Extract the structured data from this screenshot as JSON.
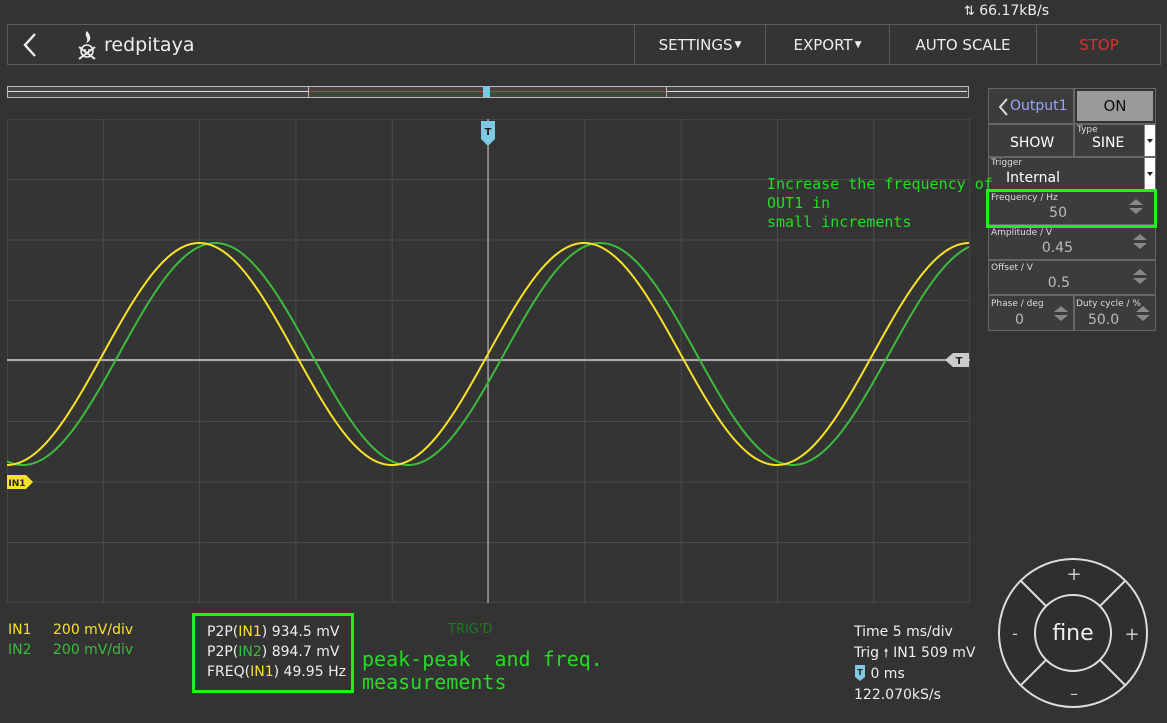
{
  "status": {
    "net_speed": "66.17kB/s"
  },
  "navbar": {
    "brand": "redpitaya",
    "settings_label": "SETTINGS",
    "export_label": "EXPORT",
    "autoscale_label": "AUTO SCALE",
    "stop_label": "STOP"
  },
  "colors": {
    "in1": "#f7e227",
    "in2": "#3dbb3d",
    "stop": "#e03030",
    "trigger_marker": "#7ec8e3",
    "highlight": "#22ee22"
  },
  "graph": {
    "trigger_marker_label": "T",
    "trigger_level_label": "T",
    "in1_marker_label": "IN1",
    "trig_state": "TRIG'D"
  },
  "output_panel": {
    "output_label": "Output1",
    "on_label": "ON",
    "show_label": "SHOW",
    "type_label": "Type",
    "type_value": "SINE",
    "trigger_label": "Trigger",
    "trigger_value": "Internal",
    "frequency_label": "Frequency / Hz",
    "frequency_value": "50",
    "amplitude_label": "Amplitude / V",
    "amplitude_value": "0.45",
    "offset_label": "Offset / V",
    "offset_value": "0.5",
    "phase_label": "Phase / deg",
    "phase_value": "0",
    "duty_label": "Duty cycle / %",
    "duty_value": "50.0"
  },
  "annotations": {
    "frequency_hint_line1": "Increase the frequency of",
    "frequency_hint_line2": "OUT1 in",
    "frequency_hint_line3": "small increments",
    "measure_hint_line1": "peak-peak  and freq.",
    "measure_hint_line2": "measurements"
  },
  "channels": [
    {
      "name": "IN1",
      "scale": "200 mV/div"
    },
    {
      "name": "IN2",
      "scale": "200 mV/div"
    }
  ],
  "measurements": {
    "p2p_in1_prefix": "P2P(",
    "p2p_in1_ch": "IN1",
    "p2p_in1_suffix": ") 934.5 mV",
    "p2p_in2_prefix": "P2P(",
    "p2p_in2_ch": "IN2",
    "p2p_in2_suffix": ") 894.7 mV",
    "freq_in1_prefix": "FREQ(",
    "freq_in1_ch": "IN1",
    "freq_in1_suffix": ") 49.95 Hz"
  },
  "timebase": {
    "time_per_div": "Time 5 ms/div",
    "trig_prefix": "Trig",
    "trig_value": "IN1 509 mV",
    "trig_offset": "0 ms",
    "sample_rate": "122.070kS/s",
    "offset_icon_label": "T"
  },
  "wheel": {
    "plus_top": "+",
    "minus_bottom": "–",
    "minus_left": "-",
    "plus_right": "+",
    "center_label": "fine"
  }
}
